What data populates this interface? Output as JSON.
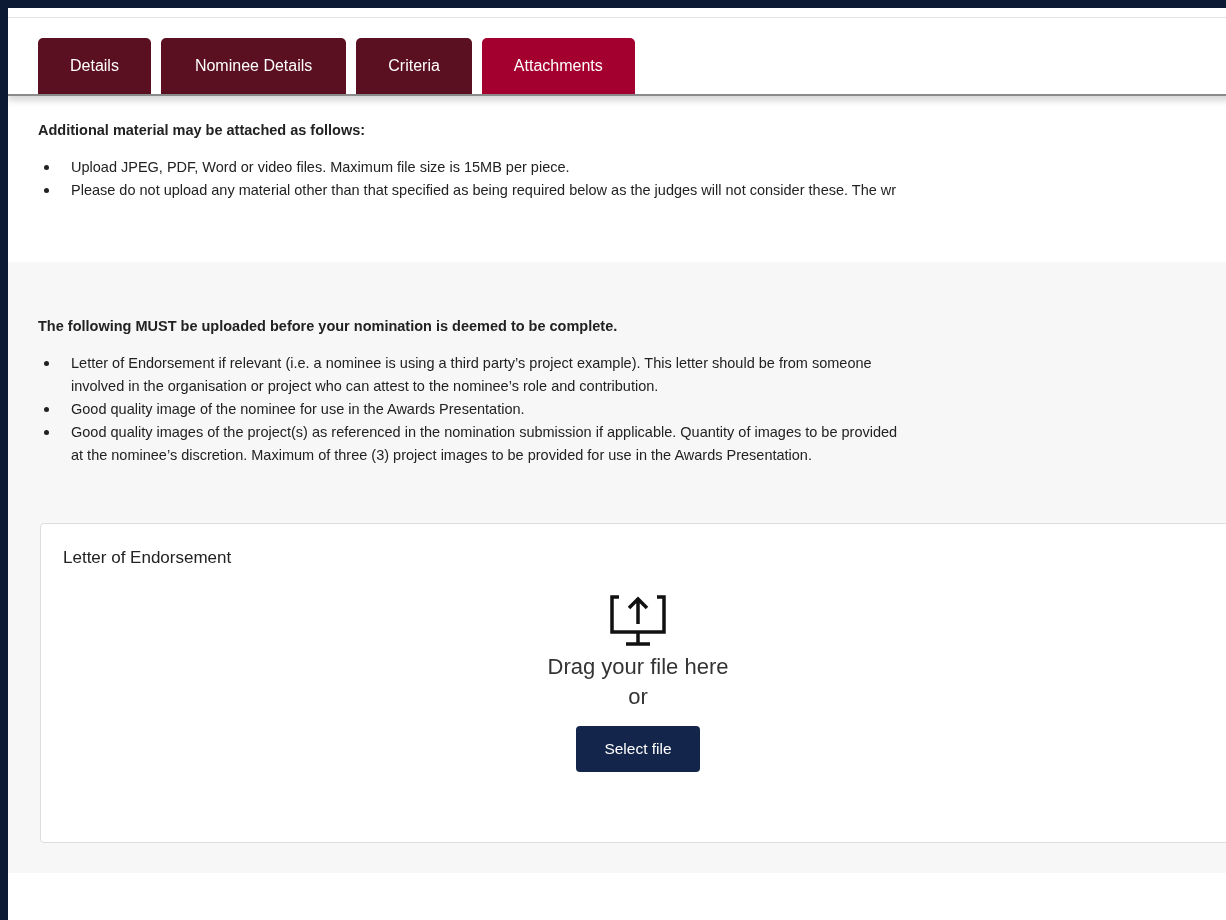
{
  "tabs": [
    {
      "label": "Details",
      "selected": false
    },
    {
      "label": "Nominee Details",
      "selected": false
    },
    {
      "label": "Criteria",
      "selected": false
    },
    {
      "label": "Attachments",
      "selected": true
    }
  ],
  "additional": {
    "heading": "Additional material may be attached as follows:",
    "items": [
      {
        "lines": [
          "Upload JPEG, PDF, Word or video files. Maximum file size is 15MB per piece."
        ]
      },
      {
        "lines": [
          "Please do not upload any material other than that specified as being required below as the judges will not consider these. The wr"
        ]
      }
    ]
  },
  "required": {
    "heading": "The following MUST be uploaded before your nomination is deemed to be complete.",
    "items": [
      {
        "lines": [
          "Letter of Endorsement if relevant (i.e. a nominee is using a third party’s project example). This letter should be from someone",
          "involved in the organisation or project who can attest to the nominee’s role and contribution."
        ]
      },
      {
        "lines": [
          "Good quality image of the nominee for use in the Awards Presentation."
        ]
      },
      {
        "lines": [
          "Good quality images of the project(s) as referenced in the nomination submission if applicable. Quantity of images to be provided",
          "at the nominee’s discretion. Maximum of three (3) project images to be provided for use in the Awards Presentation."
        ]
      }
    ]
  },
  "upload": {
    "title": "Letter of Endorsement",
    "drop_text": "Drag your file here",
    "or_text": "or",
    "button": "Select file"
  }
}
